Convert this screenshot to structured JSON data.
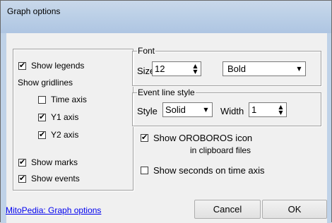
{
  "window": {
    "title": "Graph options"
  },
  "left": {
    "show_legends": {
      "label": "Show legends",
      "checked": true
    },
    "show_gridlines_label": "Show gridlines",
    "time_axis": {
      "label": "Time axis",
      "checked": false
    },
    "y1_axis": {
      "label": "Y1 axis",
      "checked": true
    },
    "y2_axis": {
      "label": "Y2 axis",
      "checked": true
    },
    "show_marks": {
      "label": "Show marks",
      "checked": true
    },
    "show_events": {
      "label": "Show events",
      "checked": true
    }
  },
  "font": {
    "group_label": "Font",
    "size_label": "Size",
    "size_value": "12",
    "weight_value": "Bold"
  },
  "event_line": {
    "group_label": "Event line style",
    "style_label": "Style",
    "style_value": "Solid",
    "width_label": "Width",
    "width_value": "1"
  },
  "options": {
    "show_icon_line1": "Show OROBOROS icon",
    "show_icon_line2": "in clipboard files",
    "show_icon_checked": true,
    "show_seconds": "Show seconds on time axis",
    "show_seconds_checked": false
  },
  "footer": {
    "help_link": "MitoPedia: Graph options",
    "cancel": "Cancel",
    "ok": "OK"
  }
}
